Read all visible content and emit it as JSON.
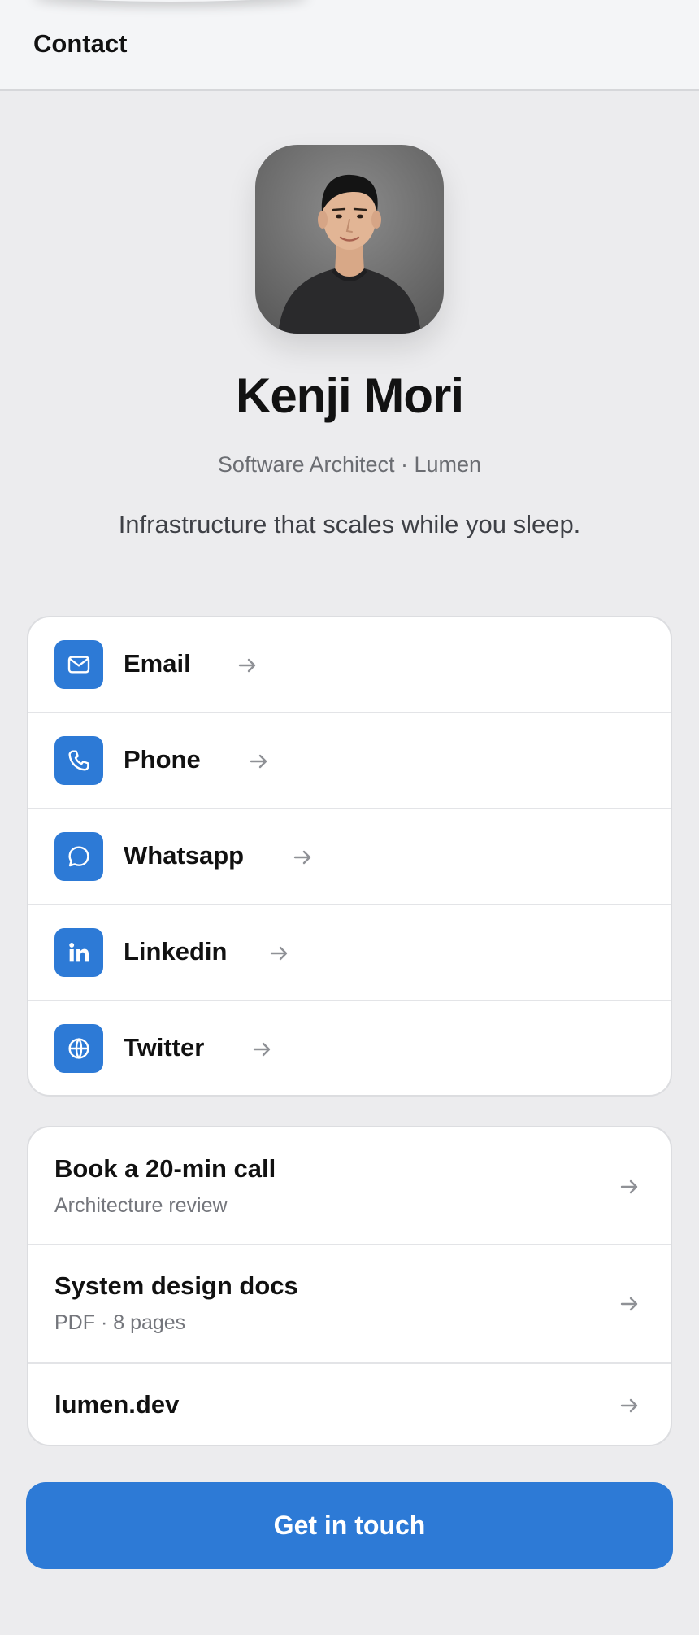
{
  "header": {
    "title": "Contact"
  },
  "profile": {
    "name": "Kenji Mori",
    "role": "Software Architect · Lumen",
    "tagline": "Infrastructure that scales while you sleep."
  },
  "social_links": [
    {
      "label": "Email",
      "icon": "mail-icon"
    },
    {
      "label": "Phone",
      "icon": "phone-icon"
    },
    {
      "label": "Whatsapp",
      "icon": "chat-bubble-icon"
    },
    {
      "label": "Linkedin",
      "icon": "linkedin-icon"
    },
    {
      "label": "Twitter",
      "icon": "globe-icon"
    }
  ],
  "resource_links": [
    {
      "title": "Book a 20-min call",
      "subtitle": "Architecture review"
    },
    {
      "title": "System design docs",
      "subtitle": "PDF · 8 pages"
    },
    {
      "title": "lumen.dev",
      "subtitle": ""
    }
  ],
  "cta": {
    "label": "Get in touch"
  },
  "colors": {
    "accent": "#2d7ad6",
    "background": "#ececee",
    "card": "#ffffff"
  }
}
